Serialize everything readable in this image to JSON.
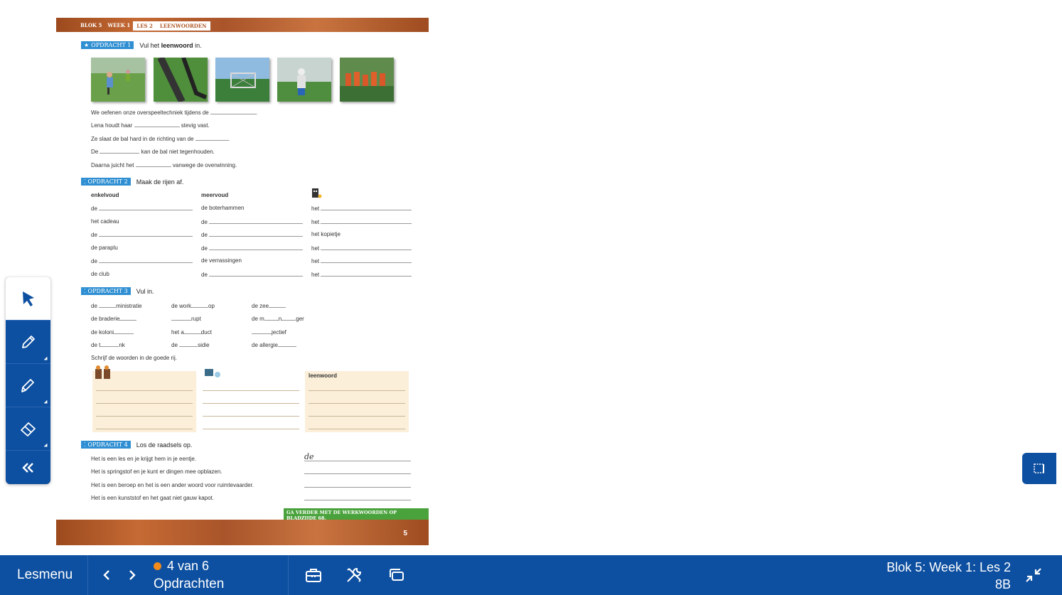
{
  "worksheet": {
    "breadcrumb": [
      "BLOK 5",
      "WEEK 1",
      "LES 2",
      "LEENWOORDEN"
    ],
    "page_number": "5",
    "opdracht1": {
      "badge": "OPDRACHT 1",
      "instruction_pre": "Vul het ",
      "instruction_bold": "leenwoord",
      "instruction_post": " in.",
      "sentences": [
        [
          "We oefenen onze overspeeltechniek tijdens de ",
          "."
        ],
        [
          "Lena houdt haar ",
          " stevig vast."
        ],
        [
          "Ze slaat de bal hard in de richting van de ",
          "."
        ],
        [
          "De ",
          " kan de bal niet tegenhouden."
        ],
        [
          "Daarna juicht het ",
          " vanwege de overwinning."
        ]
      ]
    },
    "opdracht2": {
      "badge": "OPDRACHT 2",
      "instruction": "Maak de rijen af.",
      "headers": [
        "enkelvoud",
        "meervoud"
      ],
      "rows": [
        [
          "de",
          "de boterhammen",
          "het"
        ],
        [
          "het cadeau",
          "de",
          "het"
        ],
        [
          "de",
          "de",
          "het kopietje"
        ],
        [
          "de paraplu",
          "de",
          "het"
        ],
        [
          "de",
          "de verrassingen",
          "het"
        ],
        [
          "de club",
          "de",
          "het"
        ]
      ]
    },
    "opdracht3": {
      "badge": "OPDRACHT 3",
      "instruction": "Vul in.",
      "rows": [
        [
          [
            "de ",
            "ministratie"
          ],
          [
            "de work",
            "op"
          ],
          [
            "de zee",
            ""
          ]
        ],
        [
          [
            "de braderie",
            ""
          ],
          [
            "",
            "rupt"
          ],
          [
            "de m",
            "n",
            "ger"
          ]
        ],
        [
          [
            "de koloni",
            ""
          ],
          [
            "het a",
            "duct"
          ],
          [
            "",
            "jectief"
          ]
        ],
        [
          [
            "de t",
            "nk"
          ],
          [
            "de ",
            "sidie"
          ],
          [
            "de allergie",
            ""
          ]
        ]
      ],
      "sort_instruction": "Schrijf de woorden in de goede rij.",
      "sort_header3": "leenwoord"
    },
    "opdracht4": {
      "badge": "OPDRACHT 4",
      "instruction": "Los de raadsels op.",
      "riddles": [
        "Het is een les en je krijgt hem in je eentje.",
        "Het is springstof en je kunt er dingen mee opblazen.",
        "Het is een beroep en het is een ander woord voor ruimtevaarder.",
        "Het is een kunststof en het gaat niet gauw kapot."
      ],
      "first_answer": "de"
    },
    "cta": "GA VERDER MET DE WERKWOORDEN OP BLADZIJDE 68."
  },
  "toolbar": {
    "tools": [
      "pointer-icon",
      "pen-icon",
      "highlighter-icon",
      "eraser-icon",
      "collapse-icon"
    ]
  },
  "bottombar": {
    "menu_label": "Lesmenu",
    "progress": "4 van 6",
    "section": "Opdrachten",
    "lesson": "Blok 5: Week 1: Les 2",
    "group": "8B",
    "status_color": "#f28a1c"
  }
}
